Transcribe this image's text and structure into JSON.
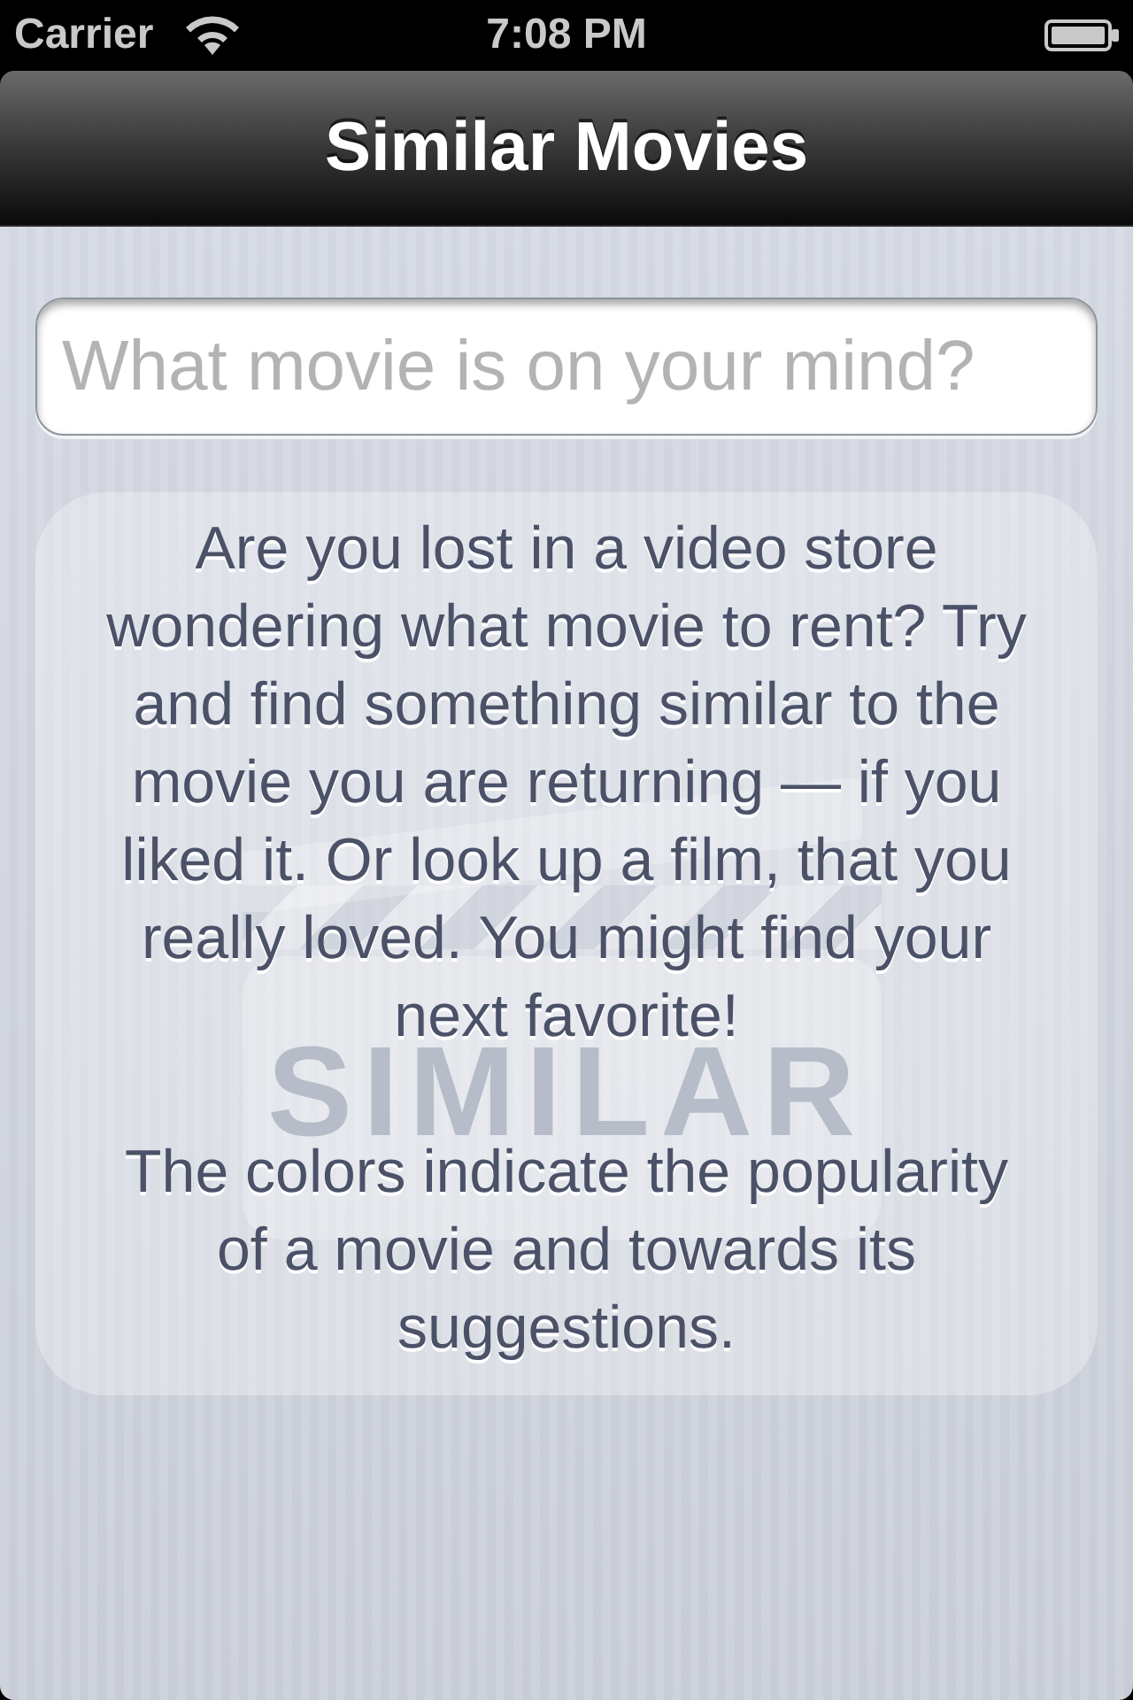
{
  "status_bar": {
    "carrier": "Carrier",
    "time": "7:08 PM"
  },
  "nav_bar": {
    "title": "Similar Movies"
  },
  "search": {
    "placeholder": "What movie is on your mind?"
  },
  "info_card": {
    "logo_text": "SIMILAR",
    "paragraphs": [
      "Are you lost in a video store wondering what movie to rent? Try and find something similar to the movie you are returning — if you liked it. Or look up a film, that you really loved. You might find your next favorite!",
      "The colors indicate the popularity of a movie and towards its suggestions."
    ]
  }
}
